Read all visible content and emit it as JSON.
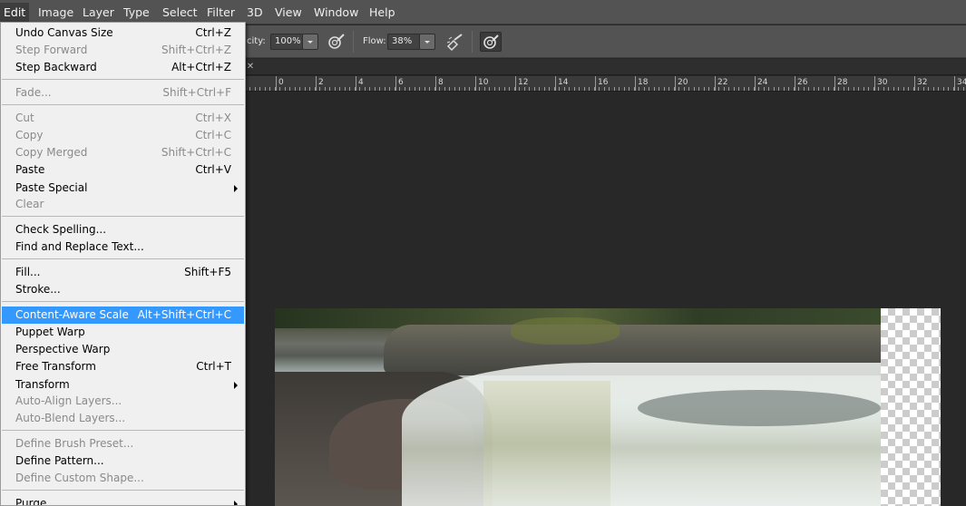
{
  "menubar": {
    "items": [
      "Edit",
      "Image",
      "Layer",
      "Type",
      "Select",
      "Filter",
      "3D",
      "View",
      "Window",
      "Help"
    ]
  },
  "options": {
    "opacity_label": "city:",
    "opacity_value": "100%",
    "flow_label": "Flow:",
    "flow_value": "38%"
  },
  "ruler": {
    "labels": [
      "0",
      "2",
      "4",
      "6",
      "8",
      "10",
      "12",
      "14",
      "16",
      "18",
      "20",
      "22",
      "24",
      "26",
      "28",
      "30",
      "32",
      "34"
    ]
  },
  "edit_menu": {
    "undo": {
      "label": "Undo Canvas Size",
      "shortcut": "Ctrl+Z"
    },
    "step_forward": {
      "label": "Step Forward",
      "shortcut": "Shift+Ctrl+Z"
    },
    "step_backward": {
      "label": "Step Backward",
      "shortcut": "Alt+Ctrl+Z"
    },
    "fade": {
      "label": "Fade...",
      "shortcut": "Shift+Ctrl+F"
    },
    "cut": {
      "label": "Cut",
      "shortcut": "Ctrl+X"
    },
    "copy": {
      "label": "Copy",
      "shortcut": "Ctrl+C"
    },
    "copy_merged": {
      "label": "Copy Merged",
      "shortcut": "Shift+Ctrl+C"
    },
    "paste": {
      "label": "Paste",
      "shortcut": "Ctrl+V"
    },
    "paste_special": {
      "label": "Paste Special"
    },
    "clear": {
      "label": "Clear"
    },
    "check_spelling": {
      "label": "Check Spelling..."
    },
    "find_replace": {
      "label": "Find and Replace Text..."
    },
    "fill": {
      "label": "Fill...",
      "shortcut": "Shift+F5"
    },
    "stroke": {
      "label": "Stroke..."
    },
    "content_aware_scale": {
      "label": "Content-Aware Scale",
      "shortcut": "Alt+Shift+Ctrl+C"
    },
    "puppet_warp": {
      "label": "Puppet Warp"
    },
    "perspective_warp": {
      "label": "Perspective Warp"
    },
    "free_transform": {
      "label": "Free Transform",
      "shortcut": "Ctrl+T"
    },
    "transform": {
      "label": "Transform"
    },
    "auto_align": {
      "label": "Auto-Align Layers..."
    },
    "auto_blend": {
      "label": "Auto-Blend Layers..."
    },
    "define_brush": {
      "label": "Define Brush Preset..."
    },
    "define_pattern": {
      "label": "Define Pattern..."
    },
    "define_shape": {
      "label": "Define Custom Shape..."
    },
    "purge": {
      "label": "Purge"
    }
  },
  "colors": {
    "menu_highlight": "#3399ff",
    "chrome": "#535353",
    "canvas": "#282828"
  }
}
